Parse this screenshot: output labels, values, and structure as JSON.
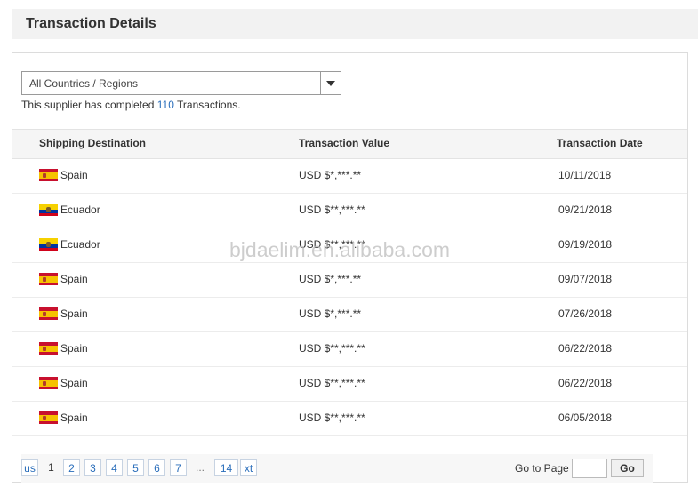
{
  "header": {
    "title": "Transaction Details"
  },
  "filter": {
    "selected": "All Countries / Regions"
  },
  "summary": {
    "prefix": "This supplier has completed",
    "count": "110",
    "suffix": "Transactions."
  },
  "table": {
    "columns": [
      "Shipping Destination",
      "Transaction Value",
      "Transaction Date"
    ],
    "rows": [
      {
        "destination": "Spain",
        "flag": "spain-flag-icon",
        "value": "USD $*,***.**",
        "date": "10/11/2018"
      },
      {
        "destination": "Ecuador",
        "flag": "ecuador-flag-icon",
        "value": "USD $**,***.**",
        "date": "09/21/2018"
      },
      {
        "destination": "Ecuador",
        "flag": "ecuador-flag-icon",
        "value": "USD $**,***.**",
        "date": "09/19/2018"
      },
      {
        "destination": "Spain",
        "flag": "spain-flag-icon",
        "value": "USD $*,***.**",
        "date": "09/07/2018"
      },
      {
        "destination": "Spain",
        "flag": "spain-flag-icon",
        "value": "USD $*,***.**",
        "date": "07/26/2018"
      },
      {
        "destination": "Spain",
        "flag": "spain-flag-icon",
        "value": "USD $**,***.**",
        "date": "06/22/2018"
      },
      {
        "destination": "Spain",
        "flag": "spain-flag-icon",
        "value": "USD $**,***.**",
        "date": "06/22/2018"
      },
      {
        "destination": "Spain",
        "flag": "spain-flag-icon",
        "value": "USD $**,***.**",
        "date": "06/05/2018"
      }
    ]
  },
  "watermark": "bjdaelim.en.alibaba.com",
  "pagination": {
    "prev": "us",
    "current": "1",
    "pages": [
      "2",
      "3",
      "4",
      "5",
      "6",
      "7"
    ],
    "ellipsis": "...",
    "last": "14",
    "next": "xt",
    "goto_label": "Go to Page",
    "goto_value": "",
    "go_button": "Go"
  },
  "colors": {
    "link": "#2a6ebb",
    "header_bg": "#f2f2f2"
  }
}
